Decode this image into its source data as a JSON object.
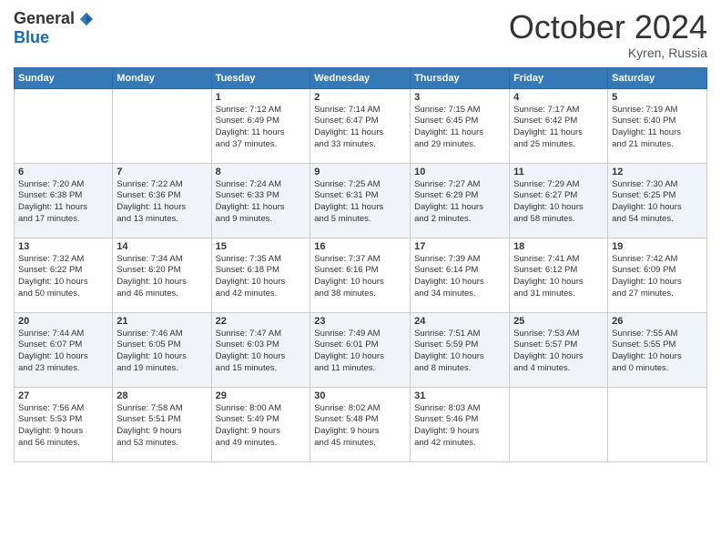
{
  "header": {
    "logo_general": "General",
    "logo_blue": "Blue",
    "month_title": "October 2024",
    "location": "Kyren, Russia"
  },
  "weekdays": [
    "Sunday",
    "Monday",
    "Tuesday",
    "Wednesday",
    "Thursday",
    "Friday",
    "Saturday"
  ],
  "weeks": [
    [
      {
        "day": "",
        "info": ""
      },
      {
        "day": "",
        "info": ""
      },
      {
        "day": "1",
        "info": "Sunrise: 7:12 AM\nSunset: 6:49 PM\nDaylight: 11 hours\nand 37 minutes."
      },
      {
        "day": "2",
        "info": "Sunrise: 7:14 AM\nSunset: 6:47 PM\nDaylight: 11 hours\nand 33 minutes."
      },
      {
        "day": "3",
        "info": "Sunrise: 7:15 AM\nSunset: 6:45 PM\nDaylight: 11 hours\nand 29 minutes."
      },
      {
        "day": "4",
        "info": "Sunrise: 7:17 AM\nSunset: 6:42 PM\nDaylight: 11 hours\nand 25 minutes."
      },
      {
        "day": "5",
        "info": "Sunrise: 7:19 AM\nSunset: 6:40 PM\nDaylight: 11 hours\nand 21 minutes."
      }
    ],
    [
      {
        "day": "6",
        "info": "Sunrise: 7:20 AM\nSunset: 6:38 PM\nDaylight: 11 hours\nand 17 minutes."
      },
      {
        "day": "7",
        "info": "Sunrise: 7:22 AM\nSunset: 6:36 PM\nDaylight: 11 hours\nand 13 minutes."
      },
      {
        "day": "8",
        "info": "Sunrise: 7:24 AM\nSunset: 6:33 PM\nDaylight: 11 hours\nand 9 minutes."
      },
      {
        "day": "9",
        "info": "Sunrise: 7:25 AM\nSunset: 6:31 PM\nDaylight: 11 hours\nand 5 minutes."
      },
      {
        "day": "10",
        "info": "Sunrise: 7:27 AM\nSunset: 6:29 PM\nDaylight: 11 hours\nand 2 minutes."
      },
      {
        "day": "11",
        "info": "Sunrise: 7:29 AM\nSunset: 6:27 PM\nDaylight: 10 hours\nand 58 minutes."
      },
      {
        "day": "12",
        "info": "Sunrise: 7:30 AM\nSunset: 6:25 PM\nDaylight: 10 hours\nand 54 minutes."
      }
    ],
    [
      {
        "day": "13",
        "info": "Sunrise: 7:32 AM\nSunset: 6:22 PM\nDaylight: 10 hours\nand 50 minutes."
      },
      {
        "day": "14",
        "info": "Sunrise: 7:34 AM\nSunset: 6:20 PM\nDaylight: 10 hours\nand 46 minutes."
      },
      {
        "day": "15",
        "info": "Sunrise: 7:35 AM\nSunset: 6:18 PM\nDaylight: 10 hours\nand 42 minutes."
      },
      {
        "day": "16",
        "info": "Sunrise: 7:37 AM\nSunset: 6:16 PM\nDaylight: 10 hours\nand 38 minutes."
      },
      {
        "day": "17",
        "info": "Sunrise: 7:39 AM\nSunset: 6:14 PM\nDaylight: 10 hours\nand 34 minutes."
      },
      {
        "day": "18",
        "info": "Sunrise: 7:41 AM\nSunset: 6:12 PM\nDaylight: 10 hours\nand 31 minutes."
      },
      {
        "day": "19",
        "info": "Sunrise: 7:42 AM\nSunset: 6:09 PM\nDaylight: 10 hours\nand 27 minutes."
      }
    ],
    [
      {
        "day": "20",
        "info": "Sunrise: 7:44 AM\nSunset: 6:07 PM\nDaylight: 10 hours\nand 23 minutes."
      },
      {
        "day": "21",
        "info": "Sunrise: 7:46 AM\nSunset: 6:05 PM\nDaylight: 10 hours\nand 19 minutes."
      },
      {
        "day": "22",
        "info": "Sunrise: 7:47 AM\nSunset: 6:03 PM\nDaylight: 10 hours\nand 15 minutes."
      },
      {
        "day": "23",
        "info": "Sunrise: 7:49 AM\nSunset: 6:01 PM\nDaylight: 10 hours\nand 11 minutes."
      },
      {
        "day": "24",
        "info": "Sunrise: 7:51 AM\nSunset: 5:59 PM\nDaylight: 10 hours\nand 8 minutes."
      },
      {
        "day": "25",
        "info": "Sunrise: 7:53 AM\nSunset: 5:57 PM\nDaylight: 10 hours\nand 4 minutes."
      },
      {
        "day": "26",
        "info": "Sunrise: 7:55 AM\nSunset: 5:55 PM\nDaylight: 10 hours\nand 0 minutes."
      }
    ],
    [
      {
        "day": "27",
        "info": "Sunrise: 7:56 AM\nSunset: 5:53 PM\nDaylight: 9 hours\nand 56 minutes."
      },
      {
        "day": "28",
        "info": "Sunrise: 7:58 AM\nSunset: 5:51 PM\nDaylight: 9 hours\nand 53 minutes."
      },
      {
        "day": "29",
        "info": "Sunrise: 8:00 AM\nSunset: 5:49 PM\nDaylight: 9 hours\nand 49 minutes."
      },
      {
        "day": "30",
        "info": "Sunrise: 8:02 AM\nSunset: 5:48 PM\nDaylight: 9 hours\nand 45 minutes."
      },
      {
        "day": "31",
        "info": "Sunrise: 8:03 AM\nSunset: 5:46 PM\nDaylight: 9 hours\nand 42 minutes."
      },
      {
        "day": "",
        "info": ""
      },
      {
        "day": "",
        "info": ""
      }
    ]
  ]
}
